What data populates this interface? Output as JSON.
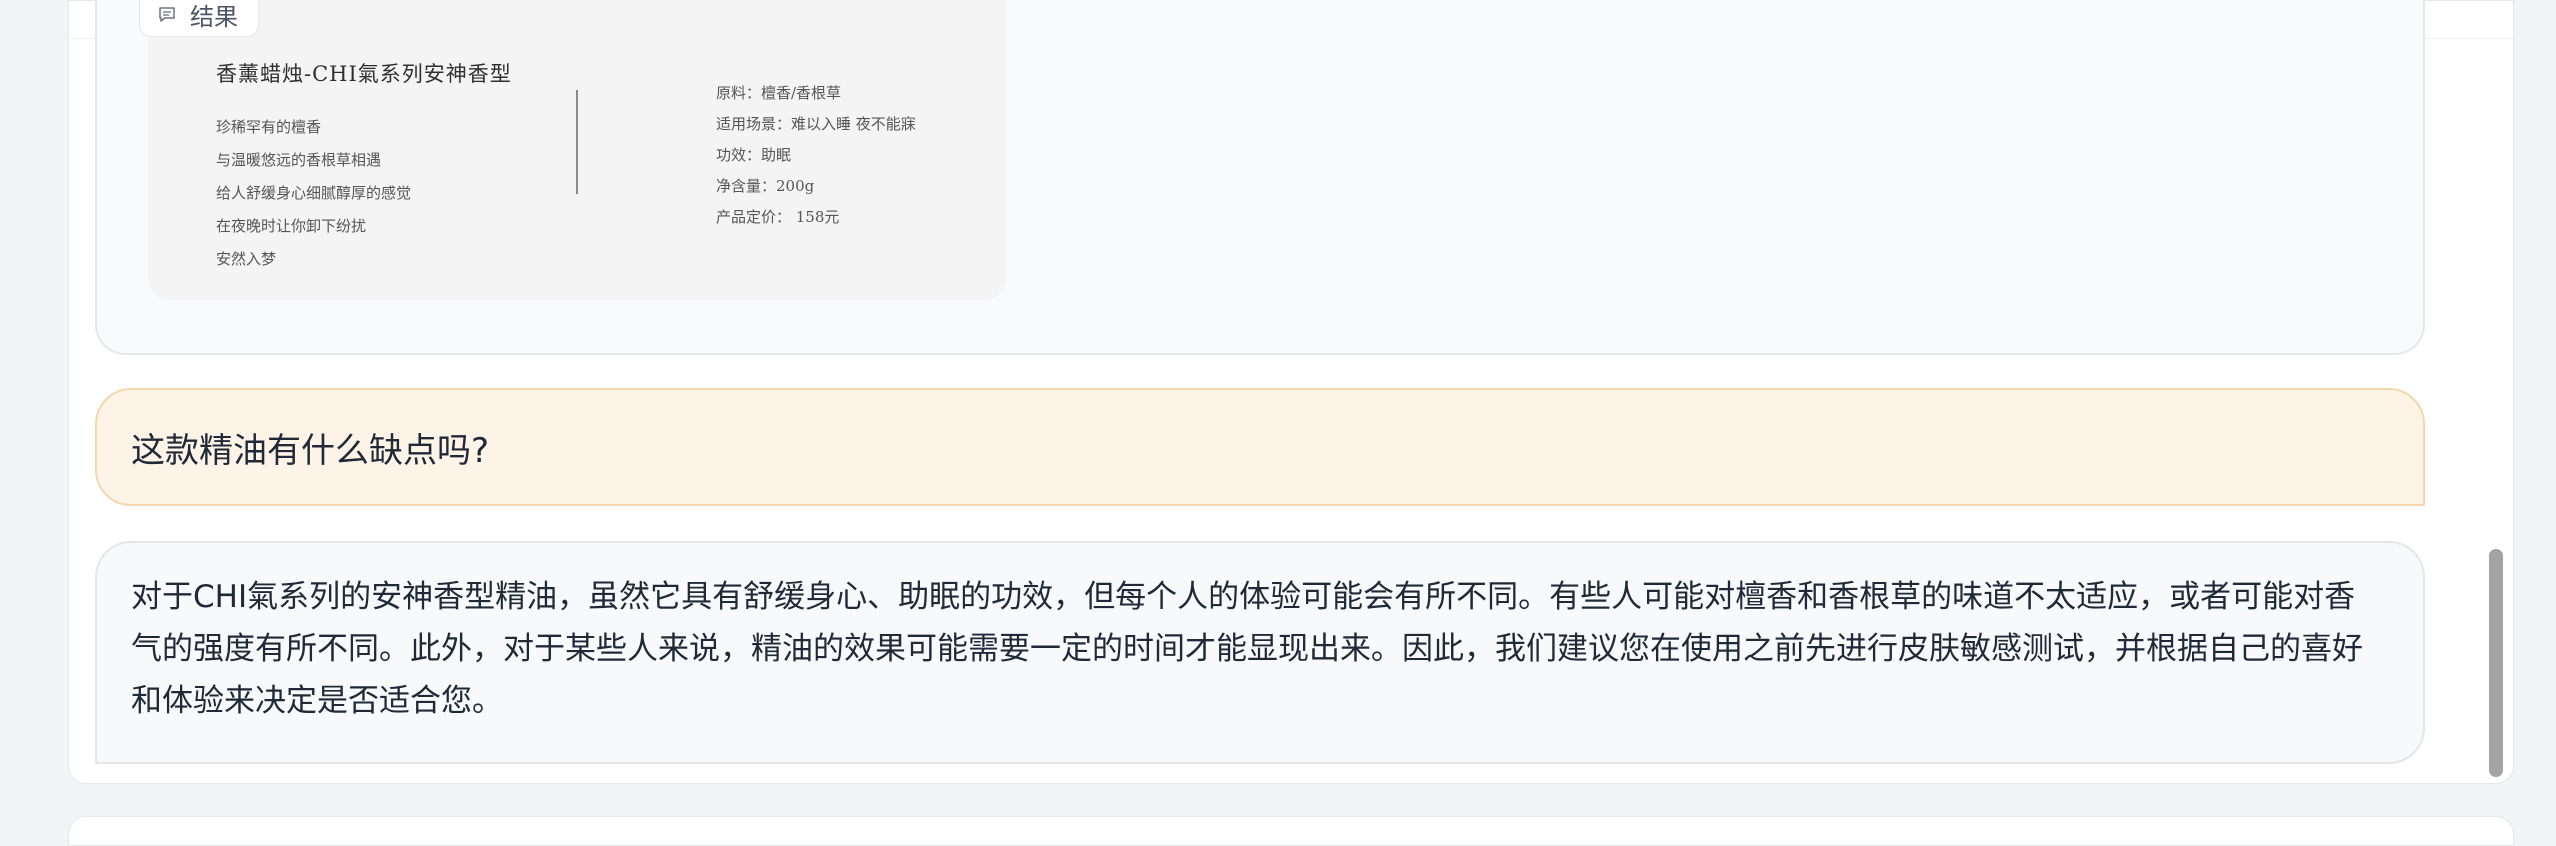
{
  "result_tab": {
    "icon": "message-icon",
    "label": "结果"
  },
  "product": {
    "title": "香薰蜡烛-CHI氣系列安神香型",
    "lines": [
      "珍稀罕有的檀香",
      "与温暖悠远的香根草相遇",
      "给人舒缓身心细腻醇厚的感觉",
      "在夜晚时让你卸下纷扰",
      "安然入梦"
    ],
    "specs": [
      "原料：檀香/香根草",
      "适用场景：难以入睡 夜不能寐",
      "功效：助眠",
      "净含量：200g",
      "产品定价： 158元"
    ]
  },
  "user_message": "这款精油有什么缺点吗?",
  "assistant_message": "对于CHI氣系列的安神香型精油，虽然它具有舒缓身心、助眠的功效，但每个人的体验可能会有所不同。有些人可能对檀香和香根草的味道不太适应，或者可能对香气的强度有所不同。此外，对于某些人来说，精油的效果可能需要一定的时间才能显现出来。因此，我们建议您在使用之前先进行皮肤敏感测试，并根据自己的喜好和体验来决定是否适合您。",
  "colors": {
    "user_bubble_bg": "#fdf3e6",
    "user_bubble_border": "#f5d7ae",
    "assistant_bubble_bg": "#f8f9fb"
  }
}
